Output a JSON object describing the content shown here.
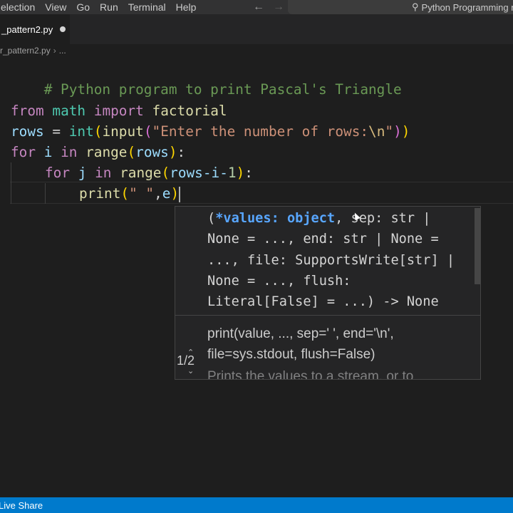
{
  "menu": {
    "items": [
      "election",
      "View",
      "Go",
      "Run",
      "Terminal",
      "Help"
    ]
  },
  "command_center": {
    "text": "Python Programming re"
  },
  "tab": {
    "label": "_pattern2.py"
  },
  "breadcrumb": {
    "file": "r_pattern2.py",
    "more": "..."
  },
  "code": {
    "line1": "# Python program to print Pascal's Triangle",
    "line3": {
      "from": "from",
      "module": "math",
      "import": "import",
      "name": "factorial"
    },
    "line4": {
      "var": "rows",
      "eq": " = ",
      "int": "int",
      "open": "(",
      "input": "input",
      "open2": "(",
      "str_a": "\"Enter the number of rows:",
      "esc": "\\n",
      "str_b": "\"",
      "close2": ")",
      "close": ")"
    },
    "line5": {
      "for": "for",
      "i": " i ",
      "in": "in",
      "range": " range",
      "open": "(",
      "rows": "rows",
      "close": ")",
      "colon": ":"
    },
    "line6": {
      "for": "for",
      "j": " j ",
      "in": "in",
      "range": " range",
      "open": "(",
      "expr": "rows-i-",
      "one": "1",
      "close": ")",
      "colon": ":"
    },
    "line7": {
      "print": "print",
      "open": "(",
      "str": "\" \"",
      "comma": ",",
      "arg": "e",
      "close": ")"
    }
  },
  "signature_help": {
    "active_param": "*values: object",
    "sig_line1_open": "(",
    "sig_line1_rest": ", sep: str |",
    "sig_line2": "None = ..., end: str | None =",
    "sig_line3": "..., file: SupportsWrite[str] |",
    "sig_line4": "None = ..., flush:",
    "sig_line5": "Literal[False] = ...) -> None",
    "doc_line1": "print(value, ..., sep=' ', end='\\n',",
    "doc_line2": "file=sys.stdout, flush=False)",
    "doc_line3": "Prints the values to a stream, or to",
    "counter": "1/2"
  },
  "statusbar": {
    "live_share": "Live Share"
  },
  "colors": {
    "statusbar": "#007acc",
    "editor_bg": "#1e1e1e",
    "active_param": "#58a6ff"
  }
}
